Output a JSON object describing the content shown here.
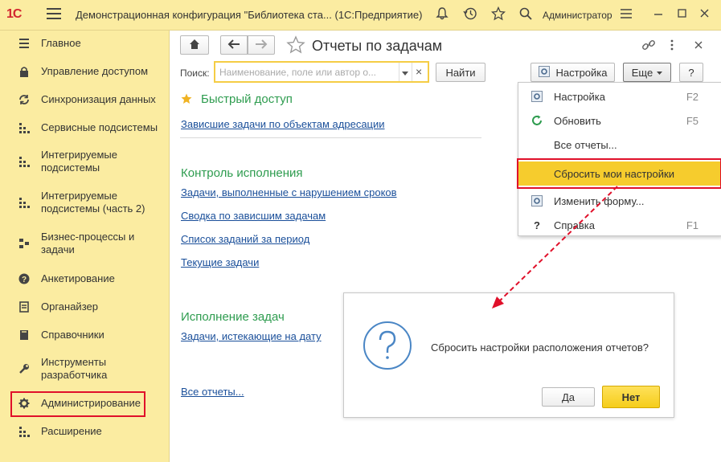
{
  "app": {
    "logo": "1С",
    "title": "Демонстрационная конфигурация \"Библиотека ста...  (1С:Предприятие)",
    "user": "Администратор"
  },
  "sidebar": {
    "items": [
      {
        "label": "Главное",
        "icon": "hamburger-icon"
      },
      {
        "label": "Управление доступом",
        "icon": "lock-icon"
      },
      {
        "label": "Синхронизация данных",
        "icon": "sync-icon"
      },
      {
        "label": "Сервисные подсистемы",
        "icon": "dots-grid-icon"
      },
      {
        "label": "Интегрируемые\nподсистемы",
        "icon": "dots-grid-icon"
      },
      {
        "label": "Интегрируемые\nподсистемы (часть 2)",
        "icon": "dots-grid-icon"
      },
      {
        "label": "Бизнес-процессы и\nзадачи",
        "icon": "business-process-icon"
      },
      {
        "label": "Анкетирование",
        "icon": "question-circle-icon"
      },
      {
        "label": "Органайзер",
        "icon": "organizer-icon"
      },
      {
        "label": "Справочники",
        "icon": "book-icon"
      },
      {
        "label": "Инструменты\nразработчика",
        "icon": "wrench-icon"
      },
      {
        "label": "Администрирование",
        "icon": "gear-icon"
      },
      {
        "label": "Расширение",
        "icon": "dots-grid-icon"
      }
    ]
  },
  "main": {
    "title": "Отчеты по задачам",
    "search": {
      "label": "Поиск:",
      "placeholder": "Наименование, поле или автор о...",
      "clear": "×"
    },
    "buttons": {
      "find": "Найти",
      "settings": "Настройка",
      "more": "Еще",
      "help": "?"
    },
    "quick_access": {
      "title": "Быстрый доступ",
      "links": [
        "Зависшие задачи по объектам адресации"
      ]
    },
    "sections": [
      {
        "title": "Контроль исполнения",
        "links": [
          "Задачи, выполненные с нарушением сроков",
          "Сводка по зависшим задачам",
          "Список заданий за период",
          "Текущие задачи"
        ]
      },
      {
        "title": "Исполнение задач",
        "links": [
          "Задачи, истекающие на дату"
        ]
      }
    ],
    "all_reports": "Все отчеты..."
  },
  "dropdown": {
    "items": [
      {
        "label": "Настройка",
        "shortcut": "F2",
        "icon": "settings-icon"
      },
      {
        "label": "Обновить",
        "shortcut": "F5",
        "icon": "refresh-icon"
      },
      {
        "label": "Все отчеты...",
        "shortcut": "",
        "icon": ""
      },
      {
        "label": "Сбросить мои настройки",
        "shortcut": "",
        "icon": ""
      },
      {
        "label": "Изменить форму...",
        "shortcut": "",
        "icon": "change-form-icon"
      },
      {
        "label": "Справка",
        "shortcut": "F1",
        "icon": "help-icon"
      }
    ]
  },
  "dialog": {
    "message": "Сбросить настройки расположения отчетов?",
    "yes": "Да",
    "no": "Нет"
  },
  "colors": {
    "panel": "#fbeca1",
    "link": "#1a4f9a",
    "section": "#2e9c4f",
    "highlight": "#f6cc2d",
    "annotation": "#e0102a"
  }
}
